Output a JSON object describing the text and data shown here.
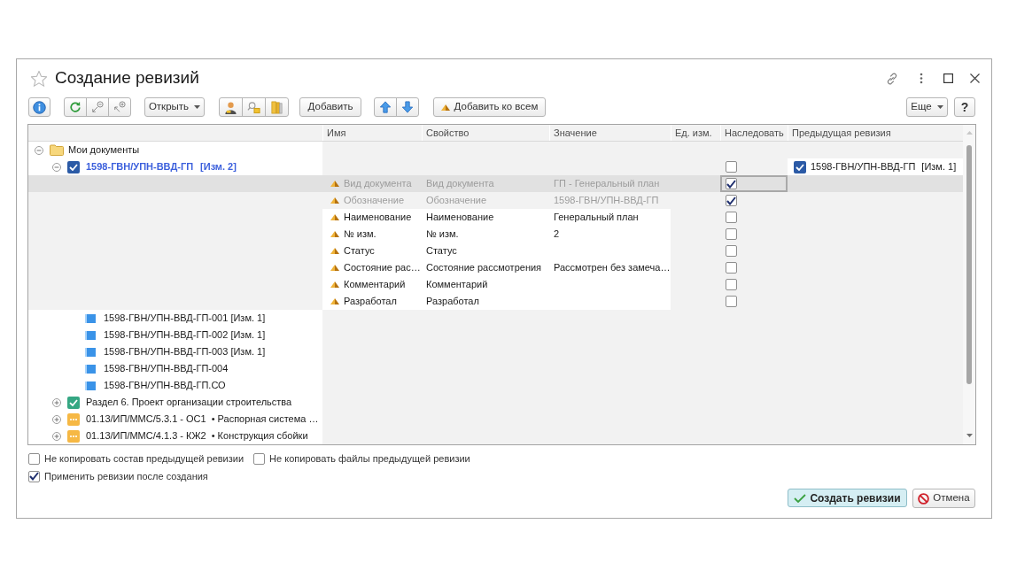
{
  "window": {
    "title": "Создание ревизий"
  },
  "toolbar": {
    "open_button": "Открыть",
    "add_button": "Добавить",
    "add_to_all_button": "Добавить ко всем",
    "more_button": "Еще",
    "help_button": "?"
  },
  "table": {
    "columns": [
      "Имя",
      "Свойство",
      "Значение",
      "Ед. изм.",
      "Наследовать",
      "Предыдущая ревизия"
    ],
    "tree": [
      {
        "kind": "folder",
        "label": "Мои документы",
        "expanded": true,
        "children": [
          {
            "kind": "revision",
            "label": "1598-ГВН/УПН-ВВД-ГП",
            "revision": "[Изм. 2]",
            "checked": true,
            "expanded": true,
            "inherit": false,
            "previous_revision": {
              "label": "1598-ГВН/УПН-ВВД-ГП",
              "revision": "[Изм. 1]",
              "checked": true
            },
            "properties": [
              {
                "name": "Вид документа",
                "property": "Вид документа",
                "value": "ГП - Генеральный план",
                "inherit": true,
                "disabled": true,
                "selected": true
              },
              {
                "name": "Обозначение",
                "property": "Обозначение",
                "value": "1598-ГВН/УПН-ВВД-ГП",
                "inherit": true,
                "disabled": true,
                "selected": false
              },
              {
                "name": "Наименование",
                "property": "Наименование",
                "value": "Генеральный план",
                "inherit": false,
                "disabled": false,
                "selected": false
              },
              {
                "name": "№ изм.",
                "property": "№ изм.",
                "value": "2",
                "inherit": false,
                "disabled": false,
                "selected": false
              },
              {
                "name": "Статус",
                "property": "Статус",
                "inherit": false,
                "disabled": false,
                "selected": false
              },
              {
                "name": "Состояние рас…",
                "property": "Состояние рассмотрения",
                "value": "Рассмотрен без замеча…",
                "inherit": false,
                "disabled": false,
                "selected": false
              },
              {
                "name": "Комментарий",
                "property": "Комментарий",
                "inherit": false,
                "disabled": false,
                "selected": false
              },
              {
                "name": "Разработал",
                "property": "Разработал",
                "inherit": false,
                "disabled": false,
                "selected": false
              }
            ],
            "children": [
              {
                "kind": "file",
                "label": "1598-ГВН/УПН-ВВД-ГП-001 [Изм. 1]"
              },
              {
                "kind": "file",
                "label": "1598-ГВН/УПН-ВВД-ГП-002 [Изм. 1]"
              },
              {
                "kind": "file",
                "label": "1598-ГВН/УПН-ВВД-ГП-003 [Изм. 1]"
              },
              {
                "kind": "file",
                "label": "1598-ГВН/УПН-ВВД-ГП-004"
              },
              {
                "kind": "file",
                "label": "1598-ГВН/УПН-ВВД-ГП.СО"
              }
            ]
          },
          {
            "kind": "approved",
            "label": "Раздел 6. Проект организации строительства",
            "expanded": false
          },
          {
            "kind": "pending",
            "label": "01.13/ИП/ММС/5.3.1 - ОС1",
            "description": "• Распорная система …",
            "expanded": false
          },
          {
            "kind": "pending",
            "label": "01.13/ИП/ММС/4.1.3 - КЖ2",
            "description": "• Конструкция сбойки",
            "expanded": false
          }
        ]
      }
    ]
  },
  "options": [
    [
      {
        "label": "Не копировать состав предыдущей ревизии",
        "checked": false
      },
      {
        "label": "Не копировать файлы предыдущей ревизии",
        "checked": false
      }
    ],
    [
      {
        "label": "Применить ревизии после создания",
        "checked": true
      }
    ]
  ],
  "buttons": [
    {
      "label": "Создать ревизии",
      "kind": "primary"
    },
    {
      "label": "Отмена",
      "kind": "cancel"
    }
  ]
}
